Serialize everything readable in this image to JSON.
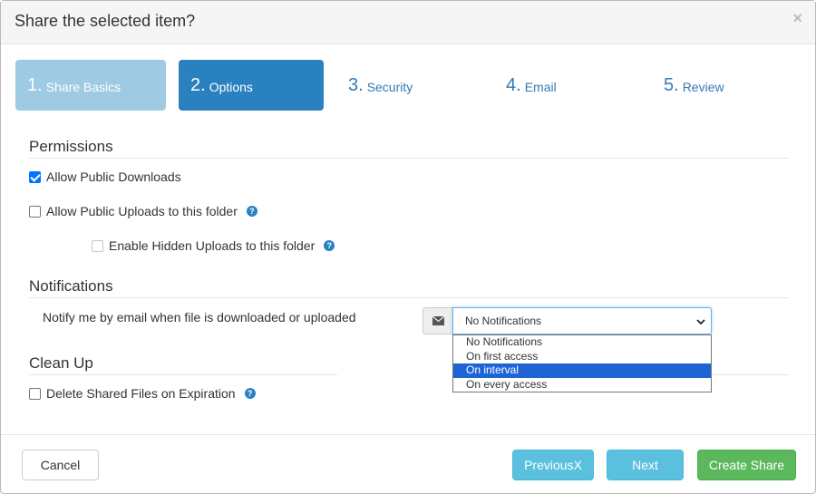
{
  "dialog": {
    "title": "Share the selected item?",
    "close_label": "×"
  },
  "steps": [
    {
      "num": "1.",
      "label": "Share Basics",
      "state": "done"
    },
    {
      "num": "2.",
      "label": "Options",
      "state": "active"
    },
    {
      "num": "3.",
      "label": "Security",
      "state": "pending"
    },
    {
      "num": "4.",
      "label": "Email",
      "state": "pending"
    },
    {
      "num": "5.",
      "label": "Review",
      "state": "pending"
    }
  ],
  "permissions": {
    "heading": "Permissions",
    "allow_downloads": {
      "label": "Allow Public Downloads",
      "checked": true
    },
    "allow_uploads": {
      "label": "Allow Public Uploads to this folder",
      "checked": false
    },
    "hidden_uploads": {
      "label": "Enable Hidden Uploads to this folder",
      "checked": false,
      "disabled": true
    }
  },
  "notifications": {
    "heading": "Notifications",
    "description": "Notify me by email when file is downloaded or uploaded",
    "addon_icon": "envelope-icon",
    "selected": "No Notifications",
    "options": [
      "No Notifications",
      "On first access",
      "On interval",
      "On every access"
    ],
    "highlighted": "On interval"
  },
  "cleanup": {
    "heading": "Clean Up",
    "delete_on_expiration": {
      "label": "Delete Shared Files on Expiration",
      "checked": false
    }
  },
  "footer": {
    "cancel": "Cancel",
    "previous": "PreviousX",
    "next": "Next",
    "create": "Create Share"
  },
  "colors": {
    "step_done": "#9fcae3",
    "step_active": "#2a81c0",
    "link": "#337ab7",
    "info_button": "#5bc0de",
    "success_button": "#5cb85c",
    "dropdown_highlight": "#1e64d4"
  }
}
